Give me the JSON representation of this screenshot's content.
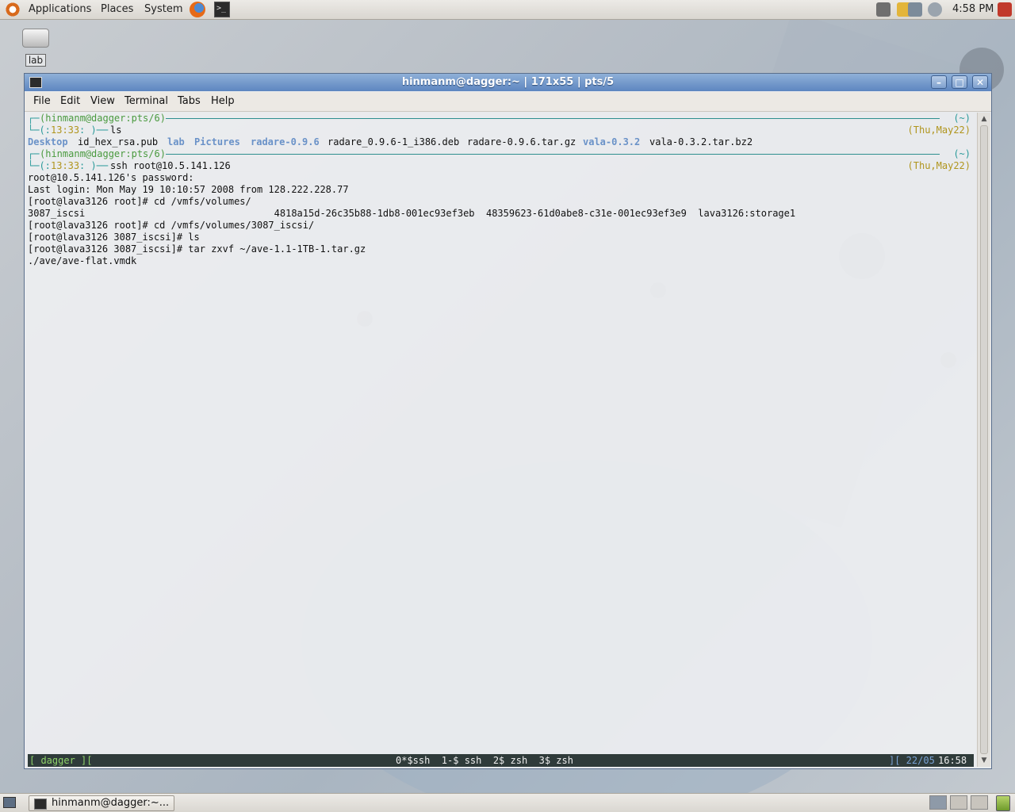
{
  "top_panel": {
    "menus": [
      "Applications",
      "Places",
      "System"
    ],
    "clock": "4:58 PM"
  },
  "desktop": {
    "icon_label": "lab"
  },
  "window": {
    "title": "hinmanm@dagger:~ | 171x55 | pts/5",
    "menu": [
      "File",
      "Edit",
      "View",
      "Terminal",
      "Tabs",
      "Help"
    ],
    "buttons": {
      "minimize": "–",
      "maximize": "□",
      "close": "✕"
    }
  },
  "terminal": {
    "prompt1": {
      "user_host": "(hinmanm@dagger:pts/6)",
      "time": "13:33",
      "command": "ls",
      "dir": "(~)",
      "date": "(Thu,May22)"
    },
    "ls_output": {
      "dirs": [
        "Desktop",
        "lab",
        "Pictures",
        "radare-0.9.6",
        "vala-0.3.2"
      ],
      "files": [
        "id_hex_rsa.pub",
        "radare_0.9.6-1_i386.deb",
        "radare-0.9.6.tar.gz",
        "vala-0.3.2.tar.bz2"
      ]
    },
    "prompt2": {
      "user_host": "(hinmanm@dagger:pts/6)",
      "time": "13:33",
      "command": "ssh root@10.5.141.126",
      "dir": "(~)",
      "date": "(Thu,May22)"
    },
    "lines": [
      "root@10.5.141.126's password:",
      "Last login: Mon May 19 10:10:57 2008 from 128.222.228.77",
      "[root@lava3126 root]# cd /vmfs/volumes/",
      "3087_iscsi                                 4818a15d-26c35b88-1db8-001ec93ef3eb  48359623-61d0abe8-c31e-001ec93ef3e9  lava3126:storage1",
      "[root@lava3126 root]# cd /vmfs/volumes/3087_iscsi/",
      "[root@lava3126 3087_iscsi]# ls",
      "[root@lava3126 3087_iscsi]# tar zxvf ~/ave-1.1-1TB-1.tar.gz",
      "./ave/ave-flat.vmdk"
    ],
    "status_bar": {
      "host": "[ dagger ][",
      "windows": "0*$ssh  1-$ ssh  2$ zsh  3$ zsh",
      "date": "][ 22/05",
      "time": "16:58 ]"
    }
  },
  "bottom_panel": {
    "task_label": "hinmanm@dagger:~..."
  },
  "colors": {
    "prompt_green": "#4a9a3f",
    "prompt_teal": "#2b9a9a",
    "prompt_olive": "#b0951d",
    "dir_blue": "#6a92c8",
    "titlebar_blue": "#5d86c0"
  }
}
